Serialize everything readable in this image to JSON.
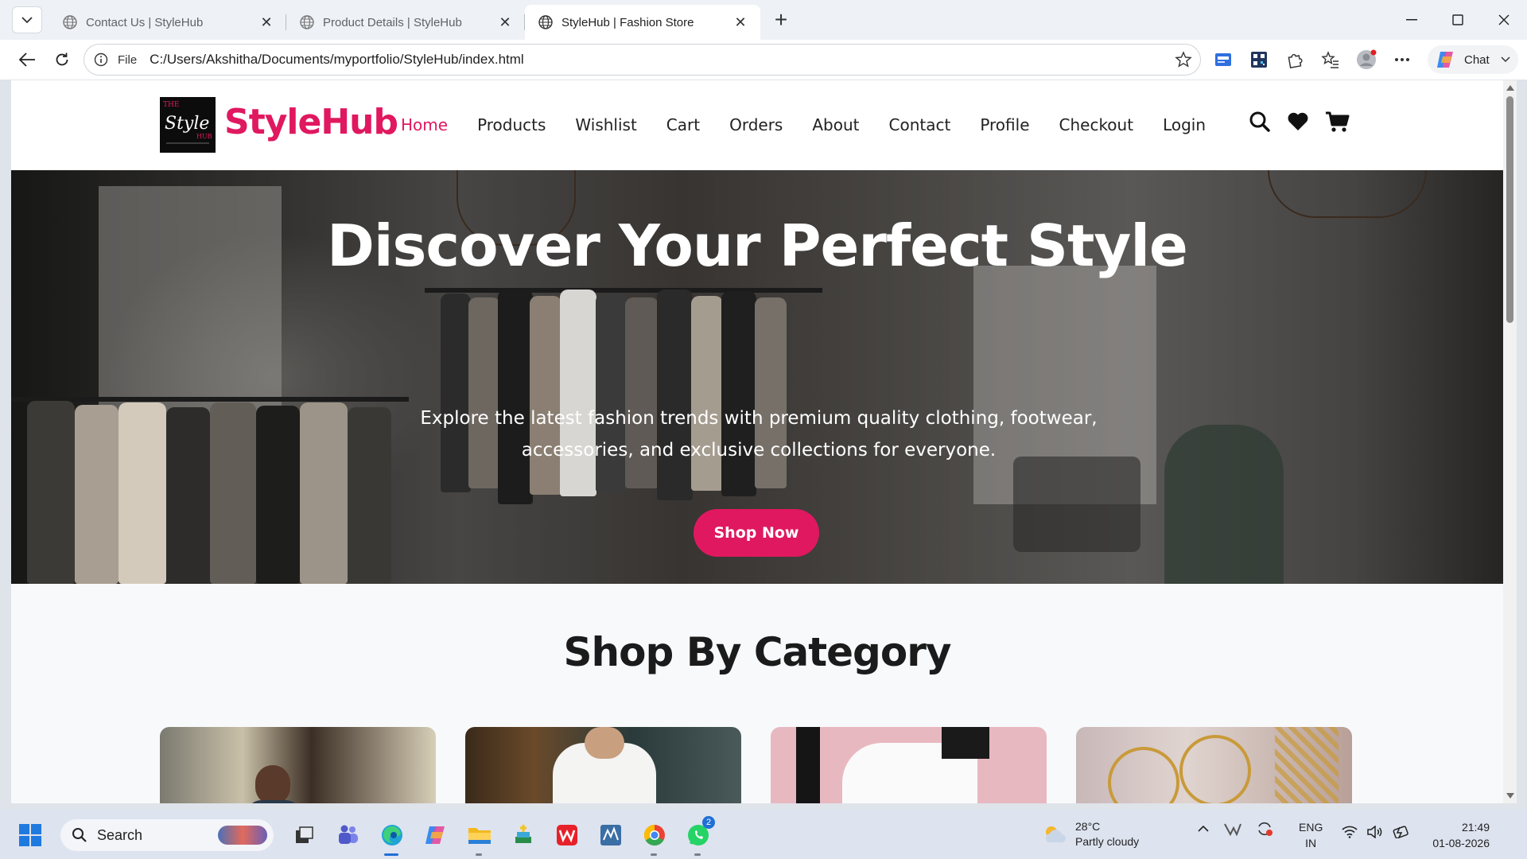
{
  "browser": {
    "tabs": [
      {
        "title": "Contact Us | StyleHub",
        "active": false
      },
      {
        "title": "Product Details | StyleHub",
        "active": false
      },
      {
        "title": "StyleHub | Fashion Store",
        "active": true
      }
    ],
    "address": {
      "scheme_label": "File",
      "url": "C:/Users/Akshitha/Documents/myportfolio/StyleHub/index.html"
    },
    "chat_label": "Chat"
  },
  "site": {
    "brand": "StyleHub",
    "logo_text": "Style",
    "nav": [
      "Home",
      "Products",
      "Wishlist",
      "Cart",
      "Orders",
      "About",
      "Contact",
      "Profile",
      "Checkout",
      "Login"
    ],
    "nav_active": "Home",
    "accent_color": "#e0185f",
    "hero": {
      "title": "Discover Your Perfect Style",
      "subtitle": "Explore the latest fashion trends with premium quality clothing, footwear, accessories, and exclusive collections for everyone.",
      "button": "Shop Now"
    },
    "section_title": "Shop By Category",
    "category_images": [
      "men-clothing-photo",
      "women-clothing-photo",
      "footwear-photo",
      "accessories-photo"
    ]
  },
  "taskbar": {
    "search_placeholder": "Search",
    "weather": {
      "temp": "28°C",
      "condition": "Partly cloudy"
    },
    "language": {
      "line1": "ENG",
      "line2": "IN"
    },
    "clock": {
      "time": "21:49",
      "date": "01-08-2026"
    },
    "whatsapp_badge": "2"
  }
}
